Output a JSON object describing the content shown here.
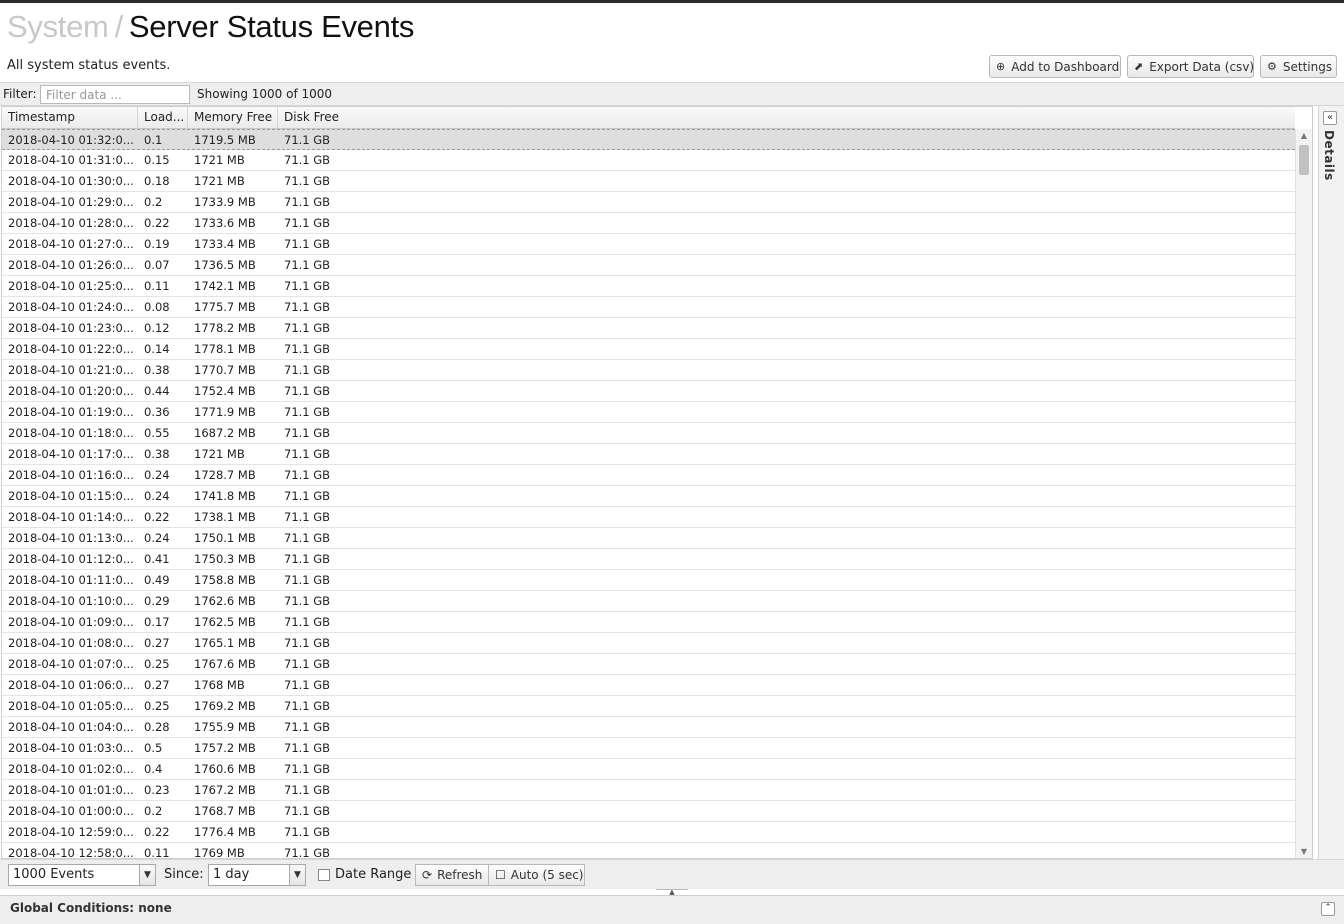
{
  "header": {
    "breadcrumb_parent": "System",
    "breadcrumb_sep": "/",
    "page_title": "Server Status Events",
    "subtitle": "All system status events.",
    "buttons": {
      "add_dashboard": "Add to Dashboard",
      "export": "Export Data (csv)",
      "settings": "Settings"
    }
  },
  "filter": {
    "label": "Filter:",
    "placeholder": "Filter data ...",
    "showing": "Showing 1000 of 1000"
  },
  "table": {
    "columns": [
      "Timestamp",
      "Load...",
      "Memory Free",
      "Disk Free"
    ],
    "rows": [
      [
        "2018-04-10 01:32:0...",
        "0.1",
        "1719.5 MB",
        "71.1 GB"
      ],
      [
        "2018-04-10 01:31:0...",
        "0.15",
        "1721 MB",
        "71.1 GB"
      ],
      [
        "2018-04-10 01:30:0...",
        "0.18",
        "1721 MB",
        "71.1 GB"
      ],
      [
        "2018-04-10 01:29:0...",
        "0.2",
        "1733.9 MB",
        "71.1 GB"
      ],
      [
        "2018-04-10 01:28:0...",
        "0.22",
        "1733.6 MB",
        "71.1 GB"
      ],
      [
        "2018-04-10 01:27:0...",
        "0.19",
        "1733.4 MB",
        "71.1 GB"
      ],
      [
        "2018-04-10 01:26:0...",
        "0.07",
        "1736.5 MB",
        "71.1 GB"
      ],
      [
        "2018-04-10 01:25:0...",
        "0.11",
        "1742.1 MB",
        "71.1 GB"
      ],
      [
        "2018-04-10 01:24:0...",
        "0.08",
        "1775.7 MB",
        "71.1 GB"
      ],
      [
        "2018-04-10 01:23:0...",
        "0.12",
        "1778.2 MB",
        "71.1 GB"
      ],
      [
        "2018-04-10 01:22:0...",
        "0.14",
        "1778.1 MB",
        "71.1 GB"
      ],
      [
        "2018-04-10 01:21:0...",
        "0.38",
        "1770.7 MB",
        "71.1 GB"
      ],
      [
        "2018-04-10 01:20:0...",
        "0.44",
        "1752.4 MB",
        "71.1 GB"
      ],
      [
        "2018-04-10 01:19:0...",
        "0.36",
        "1771.9 MB",
        "71.1 GB"
      ],
      [
        "2018-04-10 01:18:0...",
        "0.55",
        "1687.2 MB",
        "71.1 GB"
      ],
      [
        "2018-04-10 01:17:0...",
        "0.38",
        "1721 MB",
        "71.1 GB"
      ],
      [
        "2018-04-10 01:16:0...",
        "0.24",
        "1728.7 MB",
        "71.1 GB"
      ],
      [
        "2018-04-10 01:15:0...",
        "0.24",
        "1741.8 MB",
        "71.1 GB"
      ],
      [
        "2018-04-10 01:14:0...",
        "0.22",
        "1738.1 MB",
        "71.1 GB"
      ],
      [
        "2018-04-10 01:13:0...",
        "0.24",
        "1750.1 MB",
        "71.1 GB"
      ],
      [
        "2018-04-10 01:12:0...",
        "0.41",
        "1750.3 MB",
        "71.1 GB"
      ],
      [
        "2018-04-10 01:11:0...",
        "0.49",
        "1758.8 MB",
        "71.1 GB"
      ],
      [
        "2018-04-10 01:10:0...",
        "0.29",
        "1762.6 MB",
        "71.1 GB"
      ],
      [
        "2018-04-10 01:09:0...",
        "0.17",
        "1762.5 MB",
        "71.1 GB"
      ],
      [
        "2018-04-10 01:08:0...",
        "0.27",
        "1765.1 MB",
        "71.1 GB"
      ],
      [
        "2018-04-10 01:07:0...",
        "0.25",
        "1767.6 MB",
        "71.1 GB"
      ],
      [
        "2018-04-10 01:06:0...",
        "0.27",
        "1768 MB",
        "71.1 GB"
      ],
      [
        "2018-04-10 01:05:0...",
        "0.25",
        "1769.2 MB",
        "71.1 GB"
      ],
      [
        "2018-04-10 01:04:0...",
        "0.28",
        "1755.9 MB",
        "71.1 GB"
      ],
      [
        "2018-04-10 01:03:0...",
        "0.5",
        "1757.2 MB",
        "71.1 GB"
      ],
      [
        "2018-04-10 01:02:0...",
        "0.4",
        "1760.6 MB",
        "71.1 GB"
      ],
      [
        "2018-04-10 01:01:0...",
        "0.23",
        "1767.2 MB",
        "71.1 GB"
      ],
      [
        "2018-04-10 01:00:0...",
        "0.2",
        "1768.7 MB",
        "71.1 GB"
      ],
      [
        "2018-04-10 12:59:0...",
        "0.22",
        "1776.4 MB",
        "71.1 GB"
      ],
      [
        "2018-04-10 12:58:0...",
        "0.11",
        "1769 MB",
        "71.1 GB"
      ]
    ]
  },
  "details": {
    "label": "Details",
    "toggle_icon": "«"
  },
  "bottom": {
    "events_select": "1000 Events",
    "since_label": "Since:",
    "since_select": "1 day",
    "date_range_label": "Date Range",
    "refresh_label": "Refresh",
    "auto_label": "Auto (5 sec)"
  },
  "footer": {
    "text": "Global Conditions: none"
  },
  "icons": {
    "add": "add-circle-icon",
    "export": "external-link-icon",
    "settings": "gear-icon",
    "refresh": "refresh-icon",
    "dropdown": "chevron-down-icon",
    "collapse": "double-chevron-icon"
  }
}
